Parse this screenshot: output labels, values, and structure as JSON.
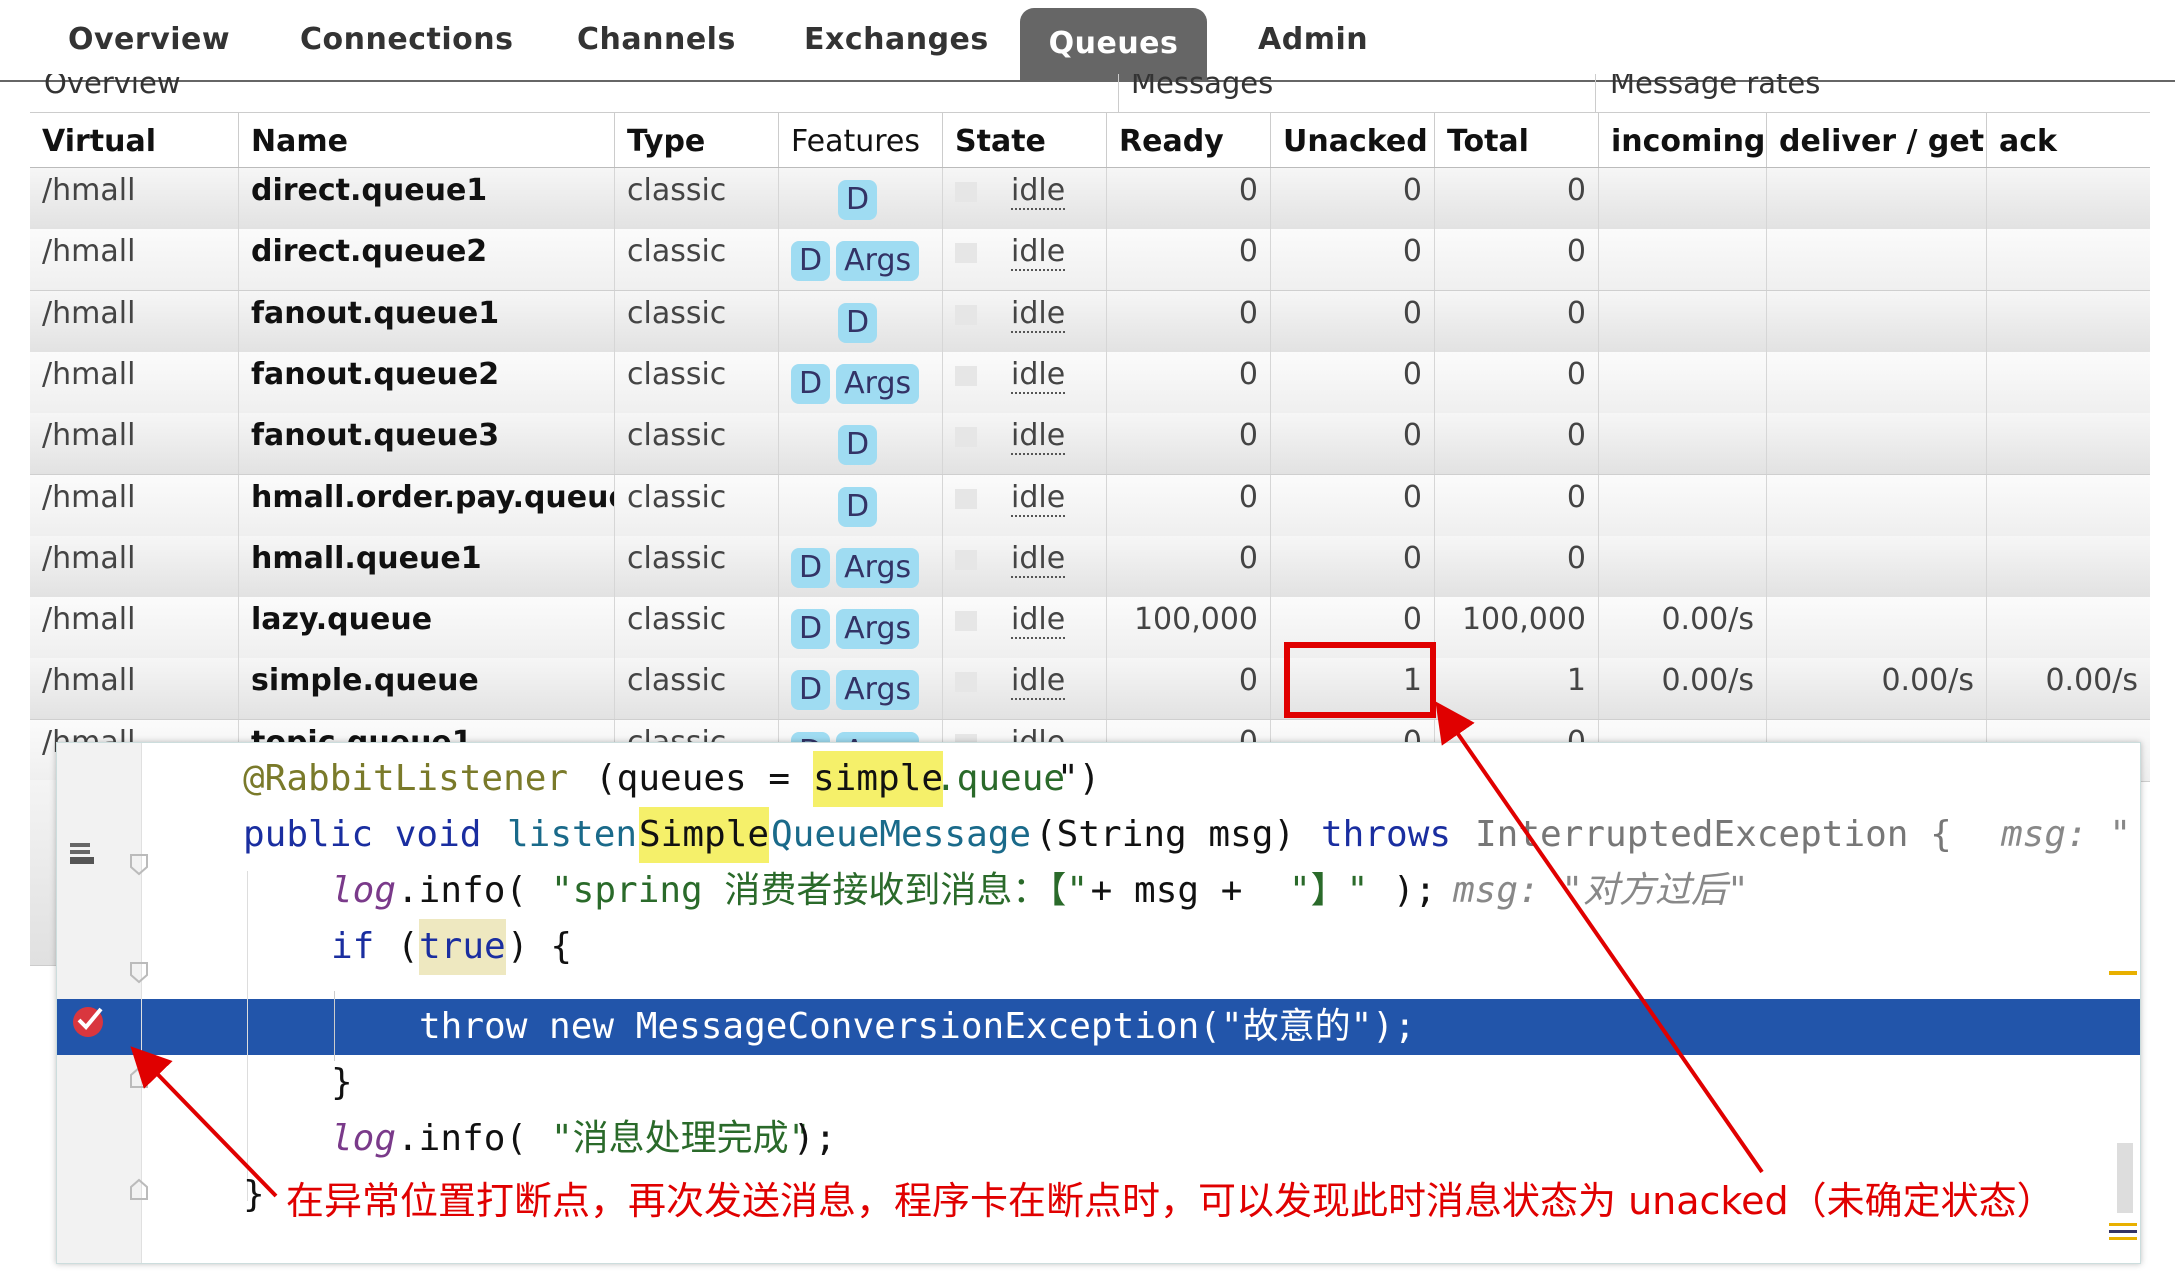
{
  "nav": {
    "tabs": [
      "Overview",
      "Connections",
      "Channels",
      "Exchanges",
      "Queues",
      "Admin"
    ],
    "active": "Queues"
  },
  "table": {
    "groups": {
      "overview": "Overview",
      "messages": "Messages",
      "rates": "Message rates"
    },
    "headers": [
      "Virtual host",
      "Name",
      "Type",
      "Features",
      "State",
      "Ready",
      "Unacked",
      "Total",
      "incoming",
      "deliver / get",
      "ack"
    ],
    "rows": [
      {
        "vhost": "/hmall",
        "name": "direct.queue1",
        "type": "classic",
        "d": "D",
        "args": "",
        "state": "idle",
        "ready": "0",
        "unacked": "0",
        "total": "0",
        "incoming": "",
        "deliver": "",
        "ack": ""
      },
      {
        "vhost": "/hmall",
        "name": "direct.queue2",
        "type": "classic",
        "d": "D",
        "args": "Args",
        "state": "idle",
        "ready": "0",
        "unacked": "0",
        "total": "0",
        "incoming": "",
        "deliver": "",
        "ack": ""
      },
      {
        "vhost": "/hmall",
        "name": "fanout.queue1",
        "type": "classic",
        "d": "D",
        "args": "",
        "state": "idle",
        "ready": "0",
        "unacked": "0",
        "total": "0",
        "incoming": "",
        "deliver": "",
        "ack": ""
      },
      {
        "vhost": "/hmall",
        "name": "fanout.queue2",
        "type": "classic",
        "d": "D",
        "args": "Args",
        "state": "idle",
        "ready": "0",
        "unacked": "0",
        "total": "0",
        "incoming": "",
        "deliver": "",
        "ack": ""
      },
      {
        "vhost": "/hmall",
        "name": "fanout.queue3",
        "type": "classic",
        "d": "D",
        "args": "",
        "state": "idle",
        "ready": "0",
        "unacked": "0",
        "total": "0",
        "incoming": "",
        "deliver": "",
        "ack": ""
      },
      {
        "vhost": "/hmall",
        "name": "hmall.order.pay.queue",
        "type": "classic",
        "d": "D",
        "args": "",
        "state": "idle",
        "ready": "0",
        "unacked": "0",
        "total": "0",
        "incoming": "",
        "deliver": "",
        "ack": ""
      },
      {
        "vhost": "/hmall",
        "name": "hmall.queue1",
        "type": "classic",
        "d": "D",
        "args": "Args",
        "state": "idle",
        "ready": "0",
        "unacked": "0",
        "total": "0",
        "incoming": "",
        "deliver": "",
        "ack": ""
      },
      {
        "vhost": "/hmall",
        "name": "lazy.queue",
        "type": "classic",
        "d": "D",
        "args": "Args",
        "state": "idle",
        "ready": "100,000",
        "unacked": "0",
        "total": "100,000",
        "incoming": "0.00/s",
        "deliver": "",
        "ack": ""
      },
      {
        "vhost": "/hmall",
        "name": "simple.queue",
        "type": "classic",
        "d": "D",
        "args": "Args",
        "state": "idle",
        "ready": "0",
        "unacked": "1",
        "total": "1",
        "incoming": "0.00/s",
        "deliver": "0.00/s",
        "ack": "0.00/s"
      },
      {
        "vhost": "/hmall",
        "name": "topic.queue1",
        "type": "classic",
        "d": "D",
        "args": "Args",
        "state": "idle",
        "ready": "0",
        "unacked": "0",
        "total": "0",
        "incoming": "",
        "deliver": "",
        "ack": ""
      }
    ]
  },
  "code": {
    "line1": {
      "a": "@RabbitListener",
      "b": "(queues = \"",
      "c": "simple",
      "d": ".queue",
      "e": "\")"
    },
    "line2": {
      "a": "public void ",
      "b": "listen",
      "c": "Simple",
      "d": "QueueMessage",
      "e": "(String msg) ",
      "f": "throws ",
      "g": "InterruptedException {",
      "h": "msg: \""
    },
    "line3": {
      "a": "log",
      "b": ".info(",
      "c": "\"spring 消费者接收到消息：【\"",
      "d": " + msg + ",
      "e": "\"】\"",
      "f": ");",
      "g": "msg: \"对方过后\""
    },
    "line4": {
      "a": "if ",
      "b": "(",
      "c": "true",
      "d": ") {"
    },
    "line5": {
      "a": "throw new MessageConversionException(\"故意的\");"
    },
    "line6": {
      "a": "}"
    },
    "line7": {
      "a": "log",
      "b": ".info(",
      "c": "\"消息处理完成\"",
      "d": ");"
    },
    "line8": {
      "a": "}"
    }
  },
  "annotation": {
    "caption": "在异常位置打断点，再次发送消息，程序卡在断点时，可以发现此时消息状态为 unacked（未确定状态）"
  },
  "colors": {
    "badge": "#9fdcf2",
    "active_tab": "#666666",
    "breakpoint_line": "#2255aa",
    "annotation": "#e00000"
  }
}
